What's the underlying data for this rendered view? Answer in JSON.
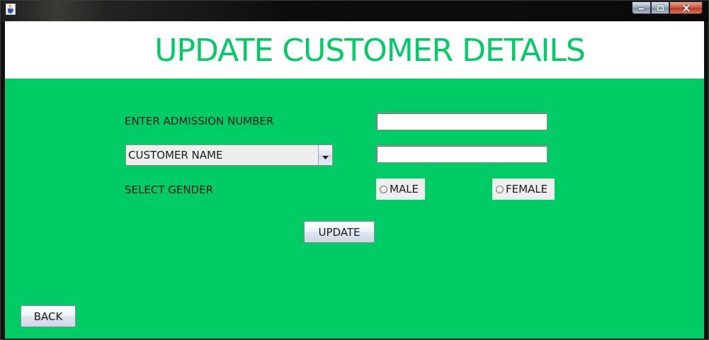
{
  "window": {
    "app_icon": "java-cup-icon",
    "controls": {
      "minimize_icon": "minimize-icon",
      "maximize_icon": "maximize-icon",
      "close_icon": "close-icon"
    }
  },
  "header": {
    "title": "UPDATE CUSTOMER DETAILS"
  },
  "form": {
    "admission_label": "ENTER ADMISSION NUMBER",
    "admission_value": "",
    "name_selector": {
      "selected": "CUSTOMER NAME",
      "arrow_icon": "chevron-down-icon"
    },
    "name_value": "",
    "gender_label": "SELECT GENDER",
    "gender_options": [
      "MALE",
      "FEMALE"
    ],
    "update_label": "UPDATE"
  },
  "footer": {
    "back_label": "BACK"
  },
  "colors": {
    "accent": "#00cc66",
    "header_bg": "#ffffff"
  }
}
